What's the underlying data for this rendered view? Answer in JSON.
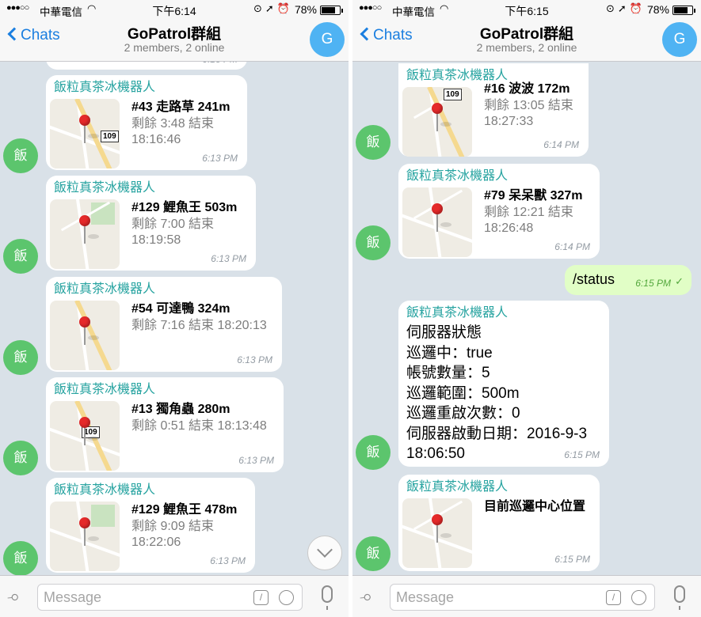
{
  "screens": [
    {
      "status": {
        "signal": "●●●○○",
        "carrier": "中華電信",
        "wifi": "wifi-icon",
        "time": "下午6:14",
        "battery": "78%",
        "battery_level": 0.78
      },
      "header": {
        "back": "Chats",
        "title": "GoPatrol群組",
        "subtitle": "2 members, 2 online",
        "avatar": "G"
      },
      "top_fragment_time": "6:13 PM",
      "messages": [
        {
          "sender": "飯粒真茶冰機器人",
          "avatar": "飯",
          "name": "#43 走路草 241m",
          "remain": [
            "剩餘 3:48 結束",
            "18:16:46"
          ],
          "time": "6:13 PM"
        },
        {
          "sender": "飯粒真茶冰機器人",
          "avatar": "飯",
          "name": "#129 鯉魚王 503m",
          "remain": [
            "剩餘 7:00 結束",
            "18:19:58"
          ],
          "time": "6:13 PM"
        },
        {
          "sender": "飯粒真茶冰機器人",
          "avatar": "飯",
          "name": "#54 可達鴨 324m",
          "remain": [
            "剩餘 7:16 結束 18:20:13",
            ""
          ],
          "time": "6:13 PM"
        },
        {
          "sender": "飯粒真茶冰機器人",
          "avatar": "飯",
          "name": "#13 獨角蟲 280m",
          "remain": [
            "剩餘 0:51 結束 18:13:48",
            ""
          ],
          "time": "6:13 PM"
        },
        {
          "sender": "飯粒真茶冰機器人",
          "avatar": "飯",
          "name": "#129 鯉魚王 478m",
          "remain": [
            "剩餘 9:09 結束",
            "18:22:06"
          ],
          "time": "6:13 PM"
        }
      ],
      "input_placeholder": "Message"
    },
    {
      "status": {
        "signal": "●●●○○",
        "carrier": "中華電信",
        "wifi": "wifi-icon",
        "time": "下午6:15",
        "battery": "78%",
        "battery_level": 0.78
      },
      "header": {
        "back": "Chats",
        "title": "GoPatrol群組",
        "subtitle": "2 members, 2 online",
        "avatar": "G"
      },
      "messages": [
        {
          "sender": "飯粒真茶冰機器人",
          "avatar": "飯",
          "name": "#16 波波 172m",
          "remain": [
            "剩餘 13:05 結束",
            "18:27:33"
          ],
          "time": "6:14 PM"
        },
        {
          "sender": "飯粒真茶冰機器人",
          "avatar": "飯",
          "name": "#79 呆呆獸 327m",
          "remain": [
            "剩餘 12:21 結束",
            "18:26:48"
          ],
          "time": "6:14 PM"
        }
      ],
      "outgoing": {
        "text": "/status",
        "time": "6:15 PM"
      },
      "status_message": {
        "sender": "飯粒真茶冰機器人",
        "avatar": "飯",
        "lines": [
          "伺服器狀態",
          "巡邏中：true",
          "帳號數量：5",
          "巡邏範圍：500m",
          "巡邏重啟次數：0",
          "伺服器啟動日期：2016-9-3",
          "18:06:50"
        ],
        "time": "6:15 PM"
      },
      "center_message": {
        "sender": "飯粒真茶冰機器人",
        "avatar": "飯",
        "text": "目前巡邏中心位置",
        "time": "6:15 PM"
      },
      "input_placeholder": "Message"
    }
  ]
}
